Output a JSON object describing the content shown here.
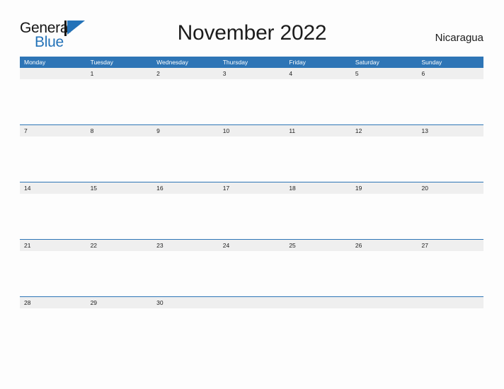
{
  "brand": {
    "name_part1": "General",
    "name_part2": "Blue",
    "flag_icon": "blue-triangle-flag-icon",
    "color_dark": "#151515",
    "color_blue": "#2372b8"
  },
  "header": {
    "title": "November 2022",
    "country": "Nicaragua"
  },
  "theme": {
    "header_blue": "#2e75b6",
    "row_band_gray": "#efefef",
    "page_background": "#fdfdfd",
    "text_dark": "#1d1d1d",
    "text_white": "#ffffff"
  },
  "calendar": {
    "month": "November",
    "year": "2022",
    "weekday_headers": [
      "Monday",
      "Tuesday",
      "Wednesday",
      "Thursday",
      "Friday",
      "Saturday",
      "Sunday"
    ],
    "weeks": [
      [
        "",
        "1",
        "2",
        "3",
        "4",
        "5",
        "6"
      ],
      [
        "7",
        "8",
        "9",
        "10",
        "11",
        "12",
        "13"
      ],
      [
        "14",
        "15",
        "16",
        "17",
        "18",
        "19",
        "20"
      ],
      [
        "21",
        "22",
        "23",
        "24",
        "25",
        "26",
        "27"
      ],
      [
        "28",
        "29",
        "30",
        "",
        "",
        "",
        ""
      ]
    ]
  }
}
